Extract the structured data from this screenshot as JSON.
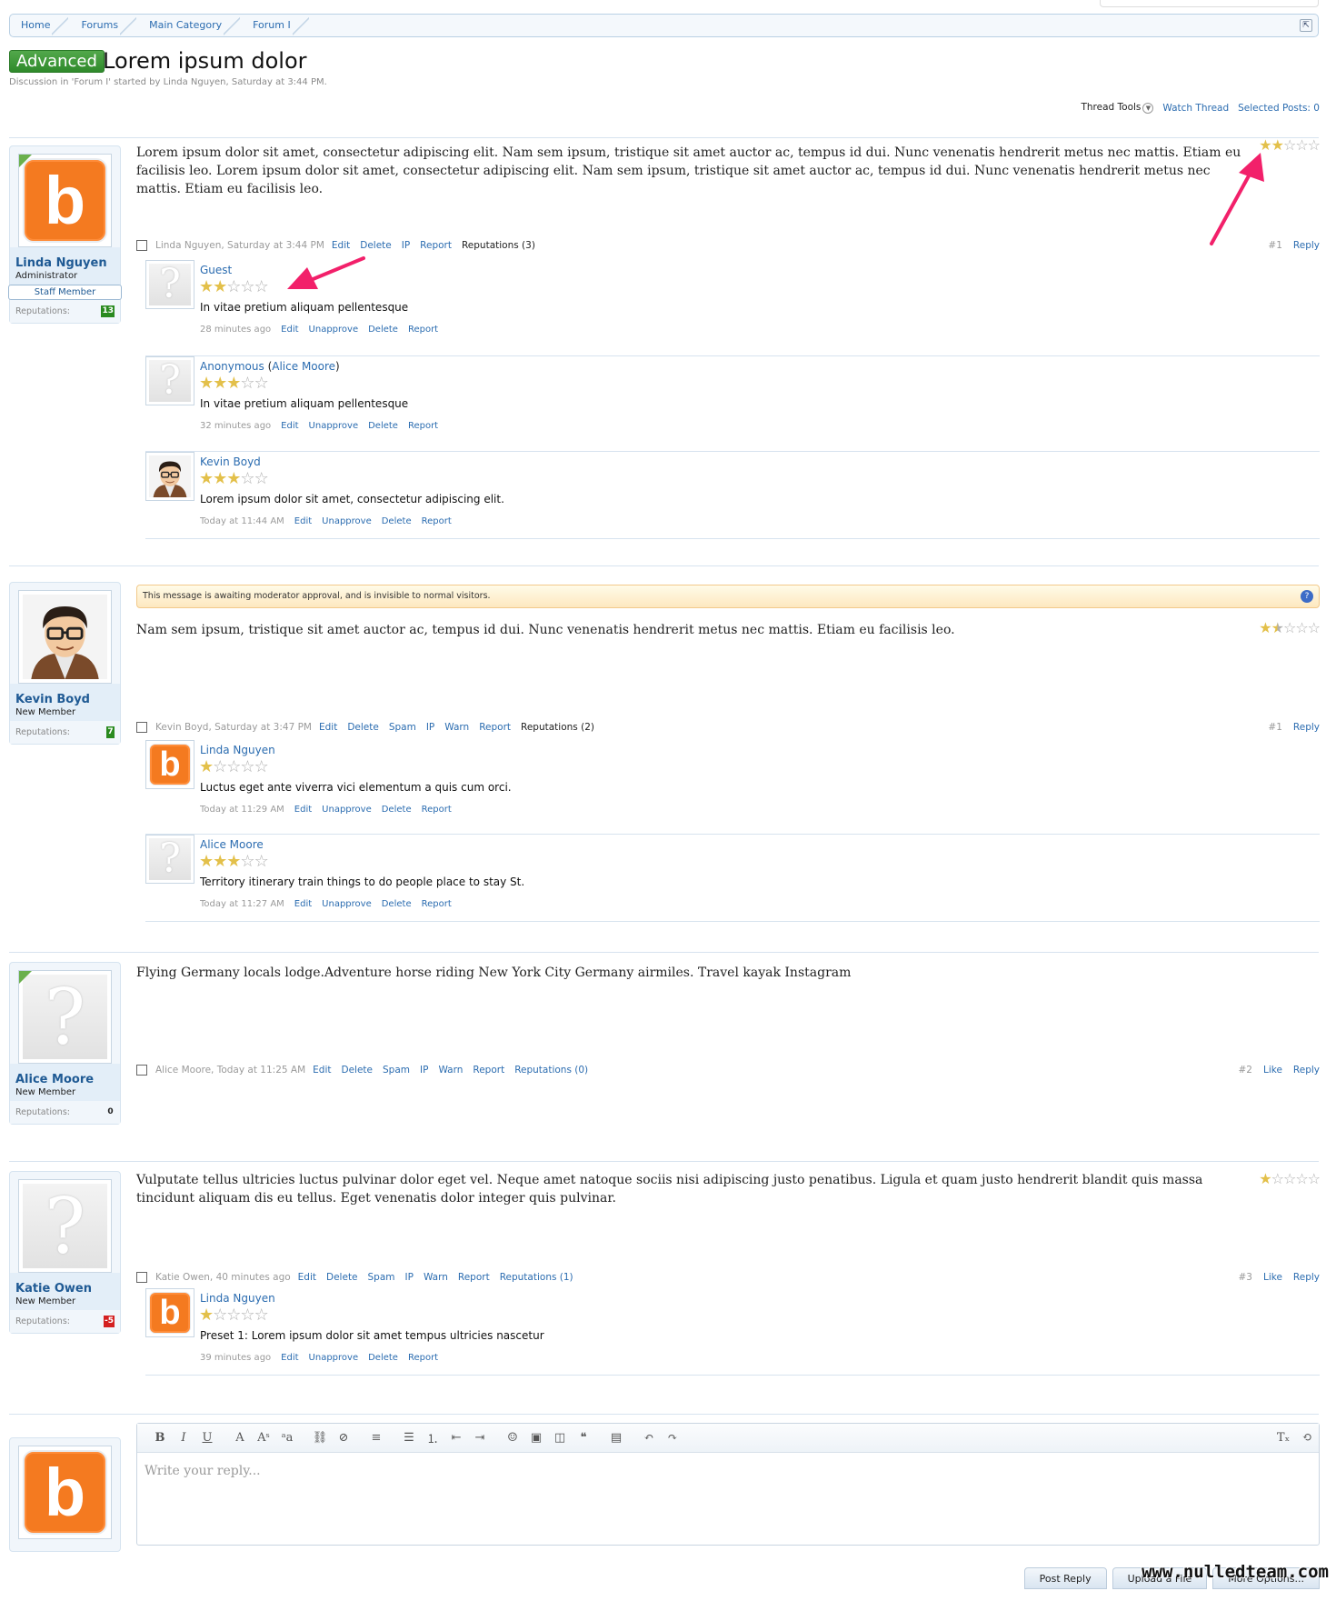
{
  "breadcrumb": [
    "Home",
    "Forums",
    "Main Category",
    "Forum I"
  ],
  "thread": {
    "prefix": "Advanced",
    "title": "Lorem ipsum dolor",
    "subtitle": "Discussion in 'Forum I' started by Linda Nguyen, Saturday at 3:44 PM."
  },
  "tools": {
    "thread_tools": "Thread Tools",
    "watch": "Watch Thread",
    "selected": "Selected Posts: 0"
  },
  "labels": {
    "reputations": "Reputations:",
    "staff_member": "Staff Member"
  },
  "posts": [
    {
      "author": "Linda Nguyen",
      "role": "Administrator",
      "reps": "13",
      "rep_color": "#2a8a1f",
      "text": "Lorem ipsum dolor sit amet, consectetur adipiscing elit. Nam sem ipsum, tristique sit amet auctor ac, tempus id dui. Nunc venenatis hendrerit metus nec mattis. Etiam eu facilisis leo. Lorem ipsum dolor sit amet, consectetur adipiscing elit. Nam sem ipsum, tristique sit amet auctor ac, tempus id dui. Nunc venenatis hendrerit metus nec mattis. Etiam eu facilisis leo.",
      "rating": 2,
      "meta_who": "Linda Nguyen, Saturday at 3:44 PM",
      "actions": [
        "Edit",
        "Delete",
        "IP",
        "Report"
      ],
      "reputations": "Reputations (3)",
      "num": "#1",
      "right": [
        "Reply"
      ],
      "replies": [
        {
          "name": "Guest",
          "rating": 2,
          "text": "In vitae pretium aliquam pellentesque",
          "time": "28 minutes ago",
          "actions": [
            "Edit",
            "Unapprove",
            "Delete",
            "Report"
          ]
        },
        {
          "name": "Anonymous",
          "name_extra": "Alice Moore",
          "rating": 3,
          "text": "In vitae pretium aliquam pellentesque",
          "time": "32 minutes ago",
          "actions": [
            "Edit",
            "Unapprove",
            "Delete",
            "Report"
          ]
        },
        {
          "name": "Kevin Boyd",
          "rating": 3,
          "text": "Lorem ipsum dolor sit amet, consectetur adipiscing elit.",
          "time": "Today at 11:44 AM",
          "actions": [
            "Edit",
            "Unapprove",
            "Delete",
            "Report"
          ]
        }
      ]
    },
    {
      "author": "Kevin Boyd",
      "role": "New Member",
      "reps": "7",
      "rep_color": "#2a8a1f",
      "notice": "This message is awaiting moderator approval, and is invisible to normal visitors.",
      "text": "Nam sem ipsum, tristique sit amet auctor ac, tempus id dui. Nunc venenatis hendrerit metus nec mattis. Etiam eu facilisis leo.",
      "rating": 1.5,
      "meta_who": "Kevin Boyd, Saturday at 3:47 PM",
      "actions": [
        "Edit",
        "Delete",
        "Spam",
        "IP",
        "Warn",
        "Report"
      ],
      "reputations": "Reputations (2)",
      "num": "#1",
      "right": [
        "Reply"
      ],
      "replies": [
        {
          "name": "Linda Nguyen",
          "rating": 1,
          "text": "Luctus eget ante viverra vici elementum a quis cum orci.",
          "time": "Today at 11:29 AM",
          "actions": [
            "Edit",
            "Unapprove",
            "Delete",
            "Report"
          ]
        },
        {
          "name": "Alice Moore",
          "rating": 3,
          "text": "Territory itinerary train things to do people place to stay St.",
          "time": "Today at 11:27 AM",
          "actions": [
            "Edit",
            "Unapprove",
            "Delete",
            "Report"
          ]
        }
      ]
    },
    {
      "author": "Alice Moore",
      "role": "New Member",
      "reps": "0",
      "rep_color": "",
      "text": "Flying Germany locals lodge.Adventure horse riding New York City Germany airmiles. Travel kayak Instagram",
      "meta_who": "Alice Moore, Today at 11:25 AM",
      "actions": [
        "Edit",
        "Delete",
        "Spam",
        "IP",
        "Warn",
        "Report",
        "Reputations (0)"
      ],
      "num": "#2",
      "right": [
        "Like",
        "Reply"
      ]
    },
    {
      "author": "Katie Owen",
      "role": "New Member",
      "reps": "-5",
      "rep_color": "#d42020",
      "text": "Vulputate tellus ultricies luctus pulvinar dolor eget vel. Neque amet natoque sociis nisi adipiscing justo penatibus. Ligula et quam justo hendrerit blandit quis massa tincidunt aliquam dis eu tellus. Eget venenatis dolor integer quis pulvinar.",
      "rating": 1,
      "meta_who": "Katie Owen, 40 minutes ago",
      "actions": [
        "Edit",
        "Delete",
        "Spam",
        "IP",
        "Warn",
        "Report",
        "Reputations (1)"
      ],
      "num": "#3",
      "right": [
        "Like",
        "Reply"
      ],
      "replies": [
        {
          "name": "Linda Nguyen",
          "rating": 1,
          "text": "Preset 1: Lorem ipsum dolor sit amet tempus ultricies nascetur",
          "time": "39 minutes ago",
          "actions": [
            "Edit",
            "Unapprove",
            "Delete",
            "Report"
          ]
        }
      ]
    }
  ],
  "editor": {
    "placeholder": "Write your reply...",
    "buttons": [
      "Post Reply",
      "Upload a File",
      "More Options..."
    ]
  },
  "watermark": "www.nulledteam.com"
}
